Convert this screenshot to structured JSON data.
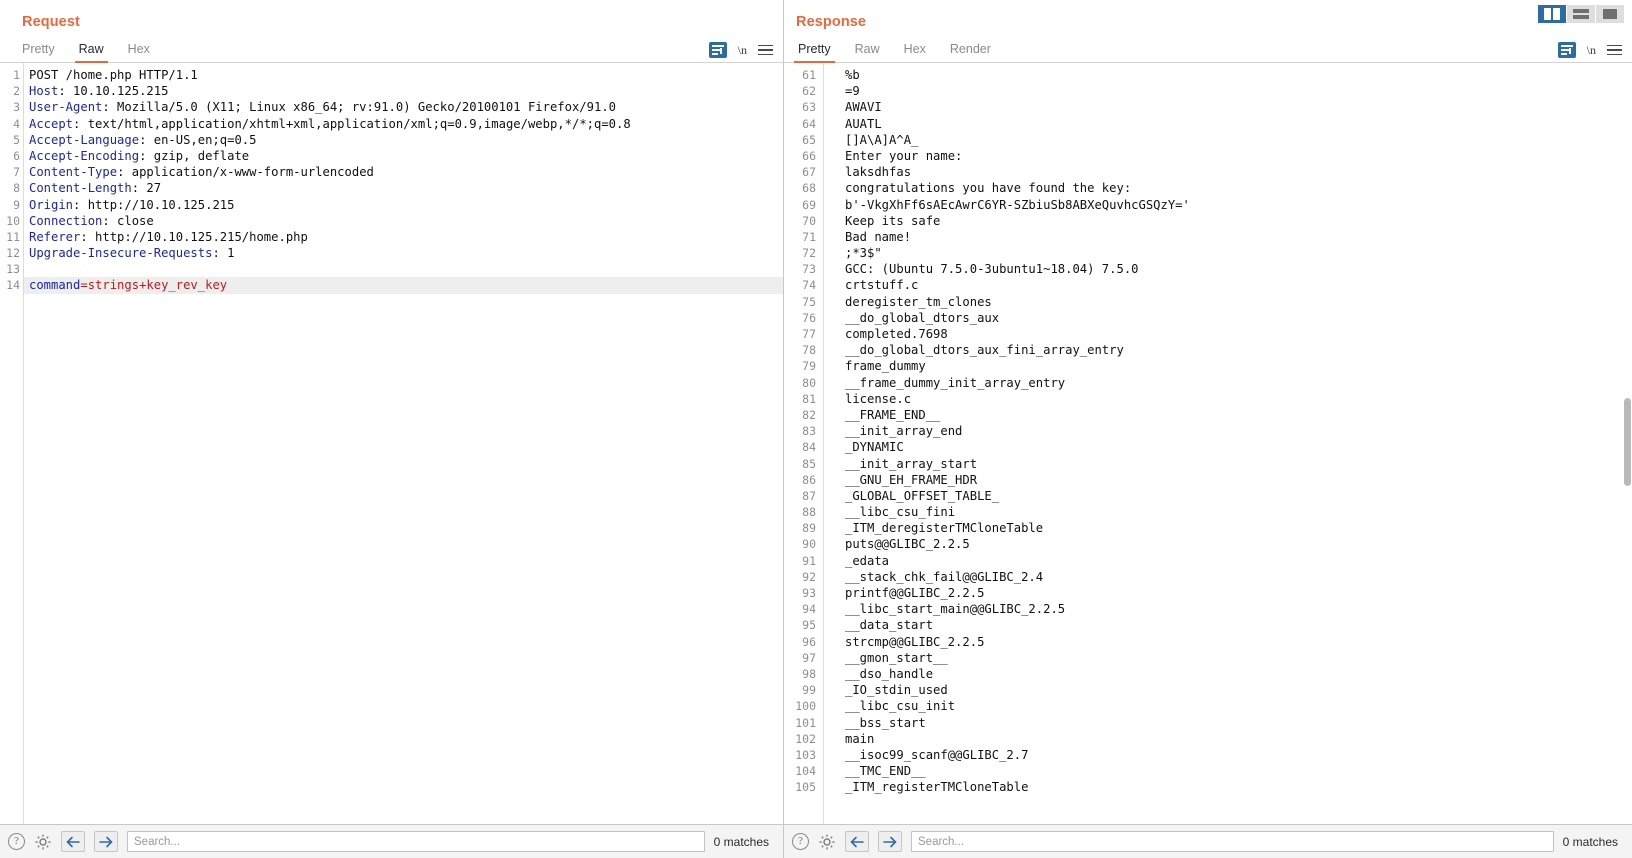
{
  "window": {
    "layout_buttons": [
      {
        "name": "side-by-side-layout",
        "icon": "split-vertical-icon",
        "selected": true
      },
      {
        "name": "stacked-layout",
        "icon": "split-horizontal-icon",
        "selected": false
      },
      {
        "name": "single-pane-layout",
        "icon": "single-pane-icon",
        "selected": false
      }
    ],
    "accent_color": "#e8683b",
    "selected_button_color": "#2c6ca5"
  },
  "request": {
    "title": "Request",
    "tabs": [
      {
        "label": "Pretty",
        "active": false
      },
      {
        "label": "Raw",
        "active": true
      },
      {
        "label": "Hex",
        "active": false
      }
    ],
    "tools": {
      "word_wrap": "word-wrap-icon",
      "newline": "\\n",
      "menu": "hamburger-menu-icon"
    },
    "lines": [
      {
        "n": 1,
        "type": "plain",
        "text": "POST /home.php HTTP/1.1"
      },
      {
        "n": 2,
        "type": "header",
        "name": "Host",
        "value": " 10.10.125.215"
      },
      {
        "n": 3,
        "type": "header",
        "name": "User-Agent",
        "value": " Mozilla/5.0 (X11; Linux x86_64; rv:91.0) Gecko/20100101 Firefox/91.0"
      },
      {
        "n": 4,
        "type": "header",
        "name": "Accept",
        "value": " text/html,application/xhtml+xml,application/xml;q=0.9,image/webp,*/*;q=0.8"
      },
      {
        "n": 5,
        "type": "header",
        "name": "Accept-Language",
        "value": " en-US,en;q=0.5"
      },
      {
        "n": 6,
        "type": "header",
        "name": "Accept-Encoding",
        "value": " gzip, deflate"
      },
      {
        "n": 7,
        "type": "header",
        "name": "Content-Type",
        "value": " application/x-www-form-urlencoded"
      },
      {
        "n": 8,
        "type": "header",
        "name": "Content-Length",
        "value": " 27"
      },
      {
        "n": 9,
        "type": "header",
        "name": "Origin",
        "value": " http://10.10.125.215"
      },
      {
        "n": 10,
        "type": "header",
        "name": "Connection",
        "value": " close"
      },
      {
        "n": 11,
        "type": "header",
        "name": "Referer",
        "value": " http://10.10.125.215/home.php"
      },
      {
        "n": 12,
        "type": "header",
        "name": "Upgrade-Insecure-Requests",
        "value": " 1"
      },
      {
        "n": 13,
        "type": "plain",
        "text": ""
      },
      {
        "n": 14,
        "type": "body",
        "name": "command",
        "value": "=strings+key_rev_key",
        "highlight": true
      }
    ],
    "statusbar": {
      "help_icon": "help-icon",
      "settings_icon": "gear-icon",
      "prev_icon": "arrow-left-icon",
      "next_icon": "arrow-right-icon",
      "search_value": "",
      "search_placeholder": "Search...",
      "matches": "0 matches"
    }
  },
  "response": {
    "title": "Response",
    "tabs": [
      {
        "label": "Pretty",
        "active": true
      },
      {
        "label": "Raw",
        "active": false
      },
      {
        "label": "Hex",
        "active": false
      },
      {
        "label": "Render",
        "active": false
      }
    ],
    "tools": {
      "word_wrap": "word-wrap-icon",
      "newline": "\\n",
      "menu": "hamburger-menu-icon"
    },
    "lines": [
      {
        "n": 61,
        "text": "%b"
      },
      {
        "n": 62,
        "text": "=9"
      },
      {
        "n": 63,
        "text": "AWAVI"
      },
      {
        "n": 64,
        "text": "AUATL"
      },
      {
        "n": 65,
        "text": "[]A\\A]A^A_"
      },
      {
        "n": 66,
        "text": "Enter your name:"
      },
      {
        "n": 67,
        "text": "laksdhfas"
      },
      {
        "n": 68,
        "text": "congratulations you have found the key:"
      },
      {
        "n": 69,
        "text": "b'-VkgXhFf6sAEcAwrC6YR-SZbiuSb8ABXeQuvhcGSQzY='"
      },
      {
        "n": 70,
        "text": "Keep its safe"
      },
      {
        "n": 71,
        "text": "Bad name!"
      },
      {
        "n": 72,
        "text": ";*3$\""
      },
      {
        "n": 73,
        "text": "GCC: (Ubuntu 7.5.0-3ubuntu1~18.04) 7.5.0"
      },
      {
        "n": 74,
        "text": "crtstuff.c"
      },
      {
        "n": 75,
        "text": "deregister_tm_clones"
      },
      {
        "n": 76,
        "text": "__do_global_dtors_aux"
      },
      {
        "n": 77,
        "text": "completed.7698"
      },
      {
        "n": 78,
        "text": "__do_global_dtors_aux_fini_array_entry"
      },
      {
        "n": 79,
        "text": "frame_dummy"
      },
      {
        "n": 80,
        "text": "__frame_dummy_init_array_entry"
      },
      {
        "n": 81,
        "text": "license.c"
      },
      {
        "n": 82,
        "text": "__FRAME_END__"
      },
      {
        "n": 83,
        "text": "__init_array_end"
      },
      {
        "n": 84,
        "text": "_DYNAMIC"
      },
      {
        "n": 85,
        "text": "__init_array_start"
      },
      {
        "n": 86,
        "text": "__GNU_EH_FRAME_HDR"
      },
      {
        "n": 87,
        "text": "_GLOBAL_OFFSET_TABLE_"
      },
      {
        "n": 88,
        "text": "__libc_csu_fini"
      },
      {
        "n": 89,
        "text": "_ITM_deregisterTMCloneTable"
      },
      {
        "n": 90,
        "text": "puts@@GLIBC_2.2.5"
      },
      {
        "n": 91,
        "text": "_edata"
      },
      {
        "n": 92,
        "text": "__stack_chk_fail@@GLIBC_2.4"
      },
      {
        "n": 93,
        "text": "printf@@GLIBC_2.2.5"
      },
      {
        "n": 94,
        "text": "__libc_start_main@@GLIBC_2.2.5"
      },
      {
        "n": 95,
        "text": "__data_start"
      },
      {
        "n": 96,
        "text": "strcmp@@GLIBC_2.2.5"
      },
      {
        "n": 97,
        "text": "__gmon_start__"
      },
      {
        "n": 98,
        "text": "__dso_handle"
      },
      {
        "n": 99,
        "text": "_IO_stdin_used"
      },
      {
        "n": 100,
        "text": "__libc_csu_init"
      },
      {
        "n": 101,
        "text": "__bss_start"
      },
      {
        "n": 102,
        "text": "main"
      },
      {
        "n": 103,
        "text": "__isoc99_scanf@@GLIBC_2.7"
      },
      {
        "n": 104,
        "text": "__TMC_END__"
      },
      {
        "n": 105,
        "text": "_ITM_registerTMCloneTable"
      }
    ],
    "statusbar": {
      "help_icon": "help-icon",
      "settings_icon": "gear-icon",
      "prev_icon": "arrow-left-icon",
      "next_icon": "arrow-right-icon",
      "search_value": "",
      "search_placeholder": "Search...",
      "matches": "0 matches"
    }
  }
}
